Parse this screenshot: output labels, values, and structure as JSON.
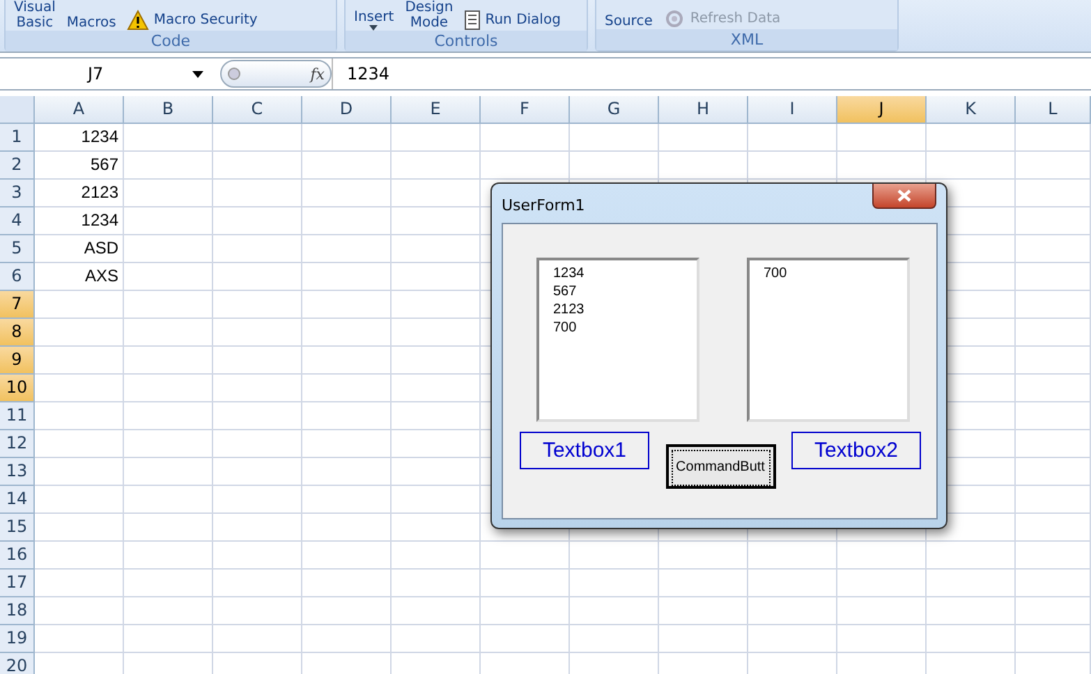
{
  "ribbon": {
    "groups": [
      {
        "label": "Code",
        "items": [
          {
            "kind": "text",
            "lines": [
              "Visual",
              "Basic"
            ]
          },
          {
            "kind": "text",
            "lines": [
              "Macros"
            ]
          },
          {
            "kind": "warning",
            "lines": [
              "Macro Security"
            ]
          }
        ]
      },
      {
        "label": "Controls",
        "items": [
          {
            "kind": "dropdown",
            "lines": [
              "Insert"
            ]
          },
          {
            "kind": "text",
            "lines": [
              "Design",
              "Mode"
            ]
          },
          {
            "kind": "dialog",
            "lines": [
              "Run Dialog"
            ]
          }
        ]
      },
      {
        "label": "XML",
        "items": [
          {
            "kind": "text",
            "lines": [
              "Source"
            ]
          },
          {
            "kind": "refresh",
            "lines": [
              "Refresh Data"
            ],
            "disabled": true
          }
        ]
      }
    ]
  },
  "formula_bar": {
    "name_box": "J7",
    "function_label": "fx",
    "value": "1234"
  },
  "sheet": {
    "columns": [
      {
        "label": "A",
        "selected": false
      },
      {
        "label": "B",
        "selected": false
      },
      {
        "label": "C",
        "selected": false
      },
      {
        "label": "D",
        "selected": false
      },
      {
        "label": "E",
        "selected": false
      },
      {
        "label": "F",
        "selected": false
      },
      {
        "label": "G",
        "selected": false
      },
      {
        "label": "H",
        "selected": false
      },
      {
        "label": "I",
        "selected": false
      },
      {
        "label": "J",
        "selected": true
      },
      {
        "label": "K",
        "selected": false
      },
      {
        "label": "L",
        "selected": false
      }
    ],
    "rows": [
      {
        "label": "1",
        "selected": false,
        "cells": [
          "1234"
        ]
      },
      {
        "label": "2",
        "selected": false,
        "cells": [
          "567"
        ]
      },
      {
        "label": "3",
        "selected": false,
        "cells": [
          "2123"
        ]
      },
      {
        "label": "4",
        "selected": false,
        "cells": [
          "1234"
        ]
      },
      {
        "label": "5",
        "selected": false,
        "cells": [
          "ASD"
        ]
      },
      {
        "label": "6",
        "selected": false,
        "cells": [
          "AXS"
        ]
      },
      {
        "label": "7",
        "selected": true,
        "cells": []
      },
      {
        "label": "8",
        "selected": true,
        "cells": []
      },
      {
        "label": "9",
        "selected": true,
        "cells": []
      },
      {
        "label": "10",
        "selected": true,
        "cells": []
      },
      {
        "label": "11",
        "selected": false,
        "cells": []
      },
      {
        "label": "12",
        "selected": false,
        "cells": []
      },
      {
        "label": "13",
        "selected": false,
        "cells": []
      },
      {
        "label": "14",
        "selected": false,
        "cells": []
      },
      {
        "label": "15",
        "selected": false,
        "cells": []
      },
      {
        "label": "16",
        "selected": false,
        "cells": []
      },
      {
        "label": "17",
        "selected": false,
        "cells": []
      },
      {
        "label": "18",
        "selected": false,
        "cells": []
      },
      {
        "label": "19",
        "selected": false,
        "cells": []
      },
      {
        "label": "20",
        "selected": false,
        "cells": []
      }
    ]
  },
  "userform": {
    "title": "UserForm1",
    "list_boxes": [
      {
        "items": [
          "1234",
          "567",
          "2123",
          "700"
        ]
      },
      {
        "items": [
          "700"
        ]
      }
    ],
    "labels": [
      "Textbox1",
      "Textbox2"
    ],
    "button": "CommandButt"
  }
}
